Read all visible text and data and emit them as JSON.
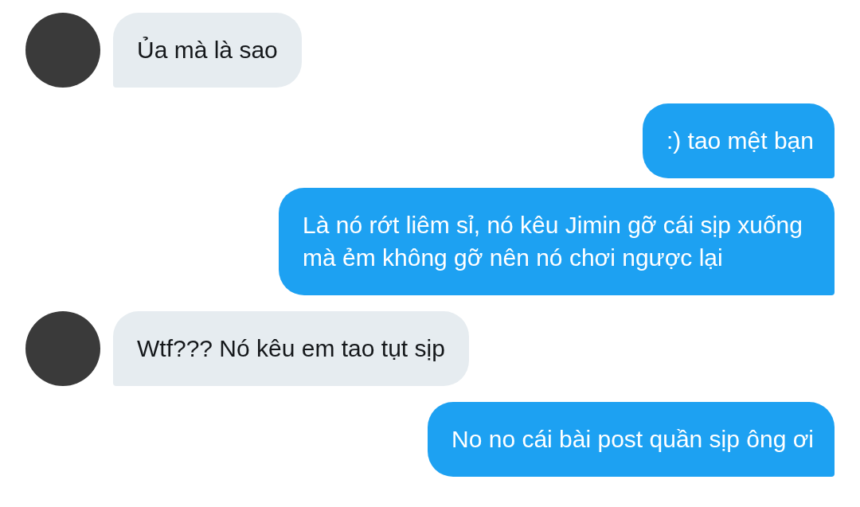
{
  "messages": [
    {
      "kind": "incoming",
      "text": "Ủa mà là sao"
    },
    {
      "kind": "outgoing",
      "text": ":) tao mệt bạn"
    },
    {
      "kind": "outgoing",
      "text": "Là nó rớt liêm sỉ, nó kêu Jimin gỡ cái sịp xuống mà ẻm không gỡ nên nó chơi ngược lại"
    },
    {
      "kind": "incoming",
      "text": "Wtf??? Nó kêu em tao tụt sịp"
    },
    {
      "kind": "outgoing",
      "text": "No no cái bài post quần sịp ông ơi"
    }
  ]
}
